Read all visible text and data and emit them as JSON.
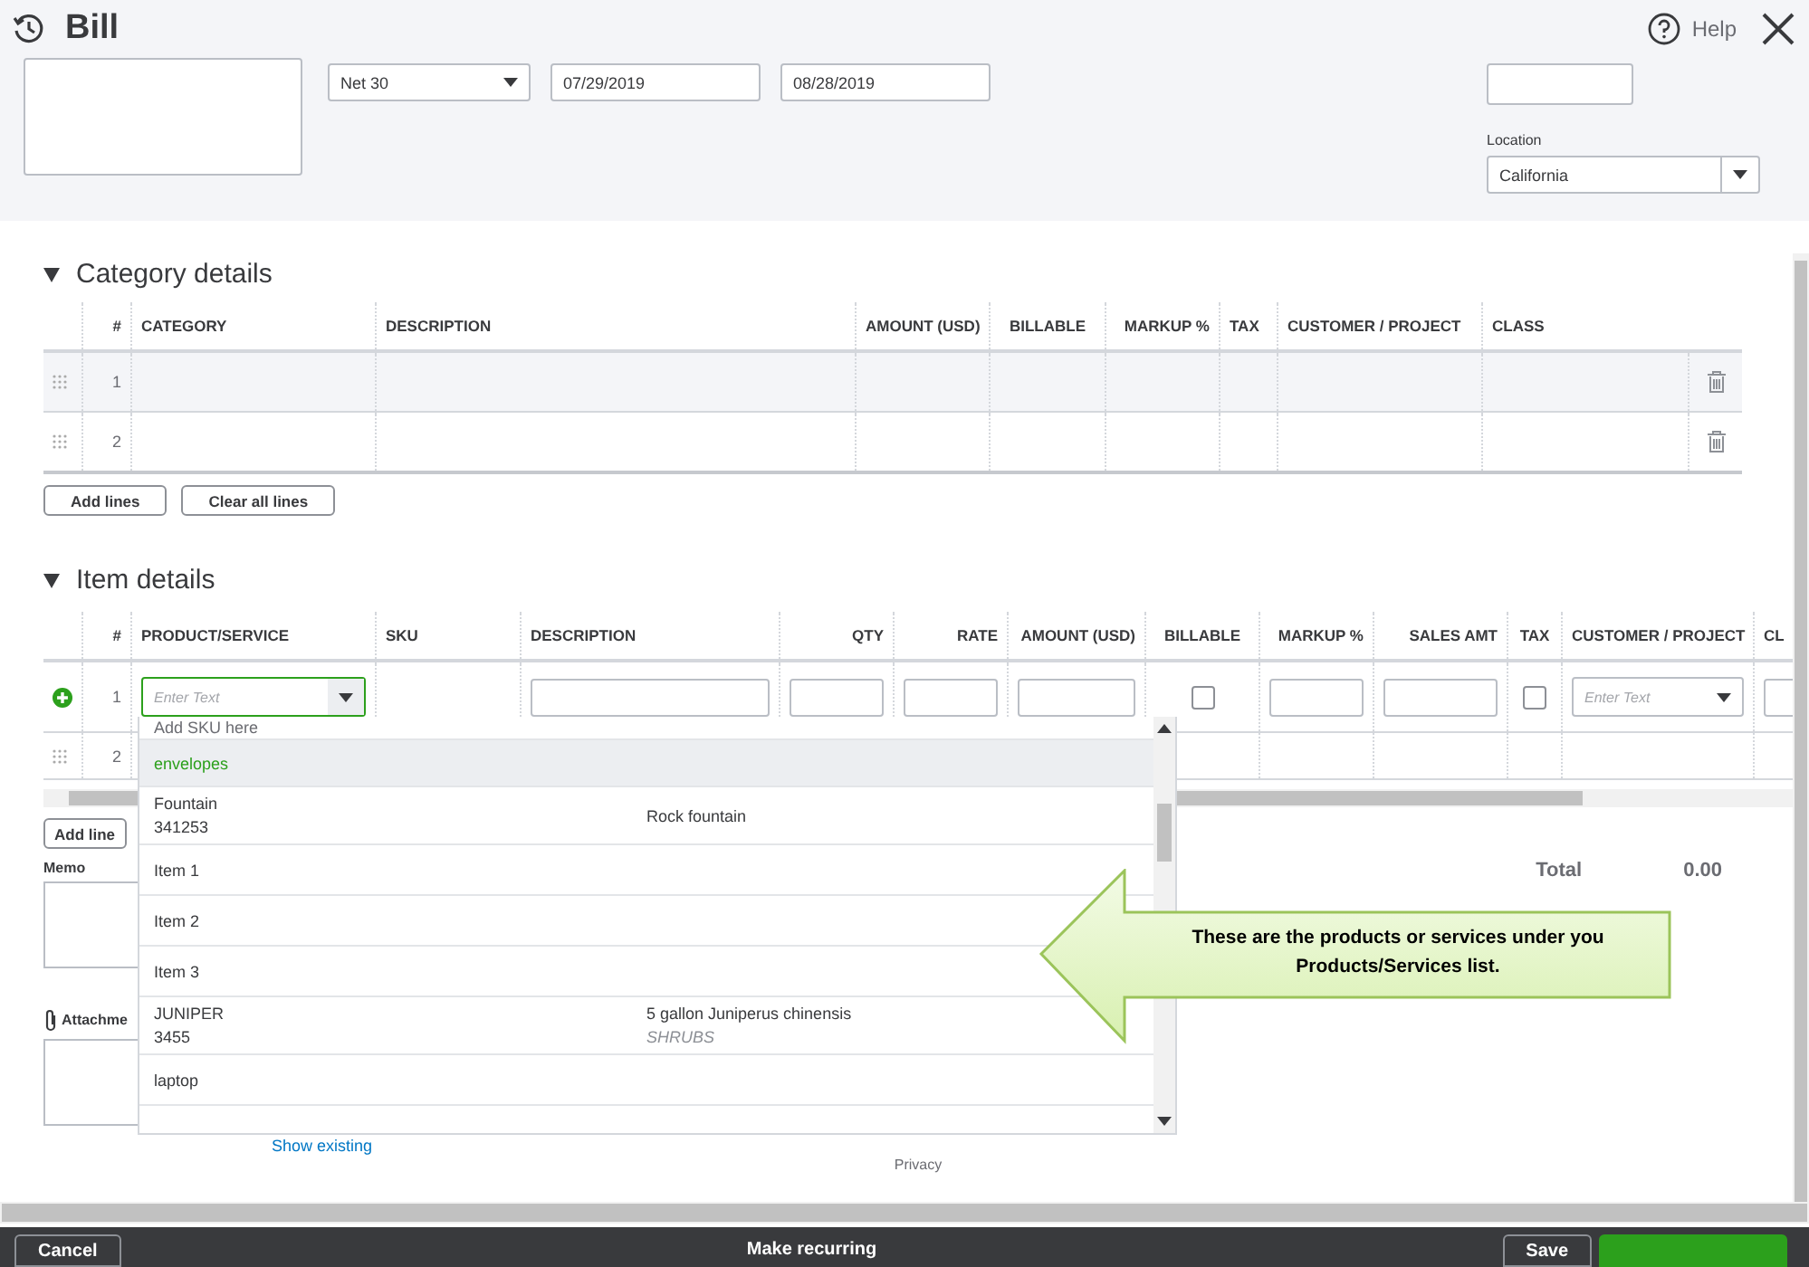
{
  "window": {
    "title": "Bill",
    "help": "Help"
  },
  "header_fields": {
    "terms": "Net 30",
    "bill_date": "07/29/2019",
    "due_date": "08/28/2019",
    "location_label": "Location",
    "location": "California"
  },
  "category_details": {
    "title": "Category details",
    "expanded": true,
    "columns": [
      "#",
      "CATEGORY",
      "DESCRIPTION",
      "AMOUNT (USD)",
      "BILLABLE",
      "MARKUP %",
      "TAX",
      "CUSTOMER / PROJECT",
      "CLASS"
    ],
    "rows": [
      {
        "number": "1",
        "highlighted": true
      },
      {
        "number": "2",
        "highlighted": false
      }
    ],
    "buttons": [
      "Add lines",
      "Clear all lines"
    ]
  },
  "item_details": {
    "title": "Item details",
    "expanded": true,
    "columns": [
      "#",
      "PRODUCT/SERVICE",
      "SKU",
      "DESCRIPTION",
      "QTY",
      "RATE",
      "AMOUNT (USD)",
      "BILLABLE",
      "MARKUP %",
      "SALES AMT",
      "TAX",
      "CUSTOMER / PROJECT",
      "CL"
    ],
    "rows": [
      {
        "number": "1",
        "kind": "edit",
        "product_placeholder": "Enter Text",
        "customer_placeholder": "Enter Text",
        "billable": false,
        "tax": false
      },
      {
        "number": "2",
        "kind": "static"
      }
    ],
    "button": "Add line"
  },
  "product_dropdown": {
    "items": [
      {
        "kind": "action",
        "name": "Add SKU here",
        "selected": false
      },
      {
        "kind": "product",
        "name": "envelopes",
        "selected": true
      },
      {
        "kind": "product",
        "name": "Fountain",
        "sku": "341253",
        "description": "Rock fountain",
        "selected": false
      },
      {
        "kind": "product",
        "name": "Item 1",
        "selected": false
      },
      {
        "kind": "product",
        "name": "Item 2",
        "selected": false
      },
      {
        "kind": "product",
        "name": "Item 3",
        "selected": false
      },
      {
        "kind": "product",
        "name": "JUNIPER",
        "sku": "3455",
        "description": "5 gallon Juniperus chinensis",
        "category": "SHRUBS",
        "selected": false
      },
      {
        "kind": "product",
        "name": "laptop",
        "selected": false
      }
    ]
  },
  "memo_label": "Memo",
  "attachments_label": "Attachme",
  "show_existing": "Show existing",
  "total": {
    "label": "Total",
    "value": "0.00"
  },
  "privacy": "Privacy",
  "callout": "These are the products or services under you Products/Services list.",
  "footer": {
    "cancel": "Cancel",
    "make_recurring": "Make recurring",
    "save": "Save"
  }
}
